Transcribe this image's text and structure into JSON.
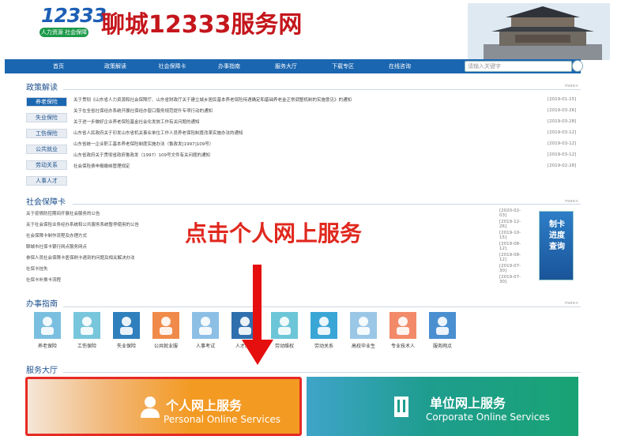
{
  "header": {
    "logo_number": "12333",
    "logo_band": "人力资源 社会保障",
    "site_title": "聊城12333服务网"
  },
  "nav": {
    "items": [
      "首页",
      "政策解读",
      "社会保障卡",
      "办事指南",
      "服务大厅",
      "下载专区",
      "在线咨询"
    ],
    "search_placeholder": "请输入关键字"
  },
  "policy": {
    "title": "政策解读",
    "more": "more+",
    "tabs": [
      "养老保险",
      "失业保险",
      "工伤保险",
      "公共就业",
      "劳动关系",
      "人事人才"
    ],
    "news": [
      {
        "title": "关于贯彻《山东省人力资源和社会保障厅、山东省财政厅关于建立城乡居民基本养老保险待遇确定和基础养老金正常调整机制的实施意见》的通知",
        "date": "[2019-01-15]"
      },
      {
        "title": "关于在全省社保经办系统开展社保经办窗口服务规范提升专项行动的通知",
        "date": "[2019-03-26]"
      },
      {
        "title": "关于进一步做好企业养老保险基金社会化发放工作有关问题的通知",
        "date": "[2019-03-28]"
      },
      {
        "title": "山东省人民政府关于印发山东省机关事业单位工作人员养老保险制度改革实施办法的通知",
        "date": "[2019-03-12]"
      },
      {
        "title": "山东省统一企业职工基本养老保险制度实施办法（鲁政发[1997]109号）",
        "date": "[2019-03-12]"
      },
      {
        "title": "山东省政府关于贯彻省政府鲁政发（1997）109号文件有关问题的通知",
        "date": "[2019-03-12]"
      },
      {
        "title": "社会保险费申报缴纳管理规定",
        "date": "[2019-02-28]"
      }
    ]
  },
  "card": {
    "title": "社会保障卡",
    "more": "more+",
    "news": [
      {
        "title": "关于疫情防控期间开展社会服务的公告",
        "date": "[2020-02-03]"
      },
      {
        "title": "关于社会保险业务经办系统和公共服务系统暂停使用的公告",
        "date": "[2019-12-26]"
      },
      {
        "title": "社会保障卡制作流程及办理方式",
        "date": "[2019-10-15]"
      },
      {
        "title": "聊城市社保卡银行网点服务网点",
        "date": "[2019-08-12]"
      },
      {
        "title": "参保人员社会保障卡医保刷卡遇到的问题及相关解决办法",
        "date": "[2019-08-12]"
      },
      {
        "title": "社保卡挂失",
        "date": "[2019-07-30]"
      },
      {
        "title": "社保卡补换卡流程",
        "date": "[2019-07-30]"
      }
    ],
    "banner": "制卡进度查询"
  },
  "guide": {
    "title": "办事指南",
    "more": "more+",
    "items": [
      {
        "label": "养老保险",
        "icon": "elderly-icon",
        "color": "#7bbfe0"
      },
      {
        "label": "工伤保险",
        "icon": "injury-icon",
        "color": "#78c6dc"
      },
      {
        "label": "失业保险",
        "icon": "unemployment-icon",
        "color": "#2f7fbd"
      },
      {
        "label": "公共就业服",
        "icon": "briefcase-icon",
        "color": "#f08a4a"
      },
      {
        "label": "人事考试",
        "icon": "exam-icon",
        "color": "#8dbfe5"
      },
      {
        "label": "人才服务",
        "icon": "talent-icon",
        "color": "#2f6fae"
      },
      {
        "label": "劳动维权",
        "icon": "rights-icon",
        "color": "#6cc6d8"
      },
      {
        "label": "劳动关系",
        "icon": "relations-icon",
        "color": "#3aa6d6"
      },
      {
        "label": "高校毕业生",
        "icon": "graduate-icon",
        "color": "#9bc7e6"
      },
      {
        "label": "专业技术人",
        "icon": "professional-icon",
        "color": "#f28a6a"
      },
      {
        "label": "服务网点",
        "icon": "outlet-icon",
        "color": "#4a8fd0"
      }
    ]
  },
  "hall": {
    "title": "服务大厅",
    "personal_zh": "个人网上服务",
    "personal_en": "Personal Online Services",
    "company_zh": "单位网上服务",
    "company_en": "Corporate Online Services"
  },
  "callout": "点击个人网上服务"
}
